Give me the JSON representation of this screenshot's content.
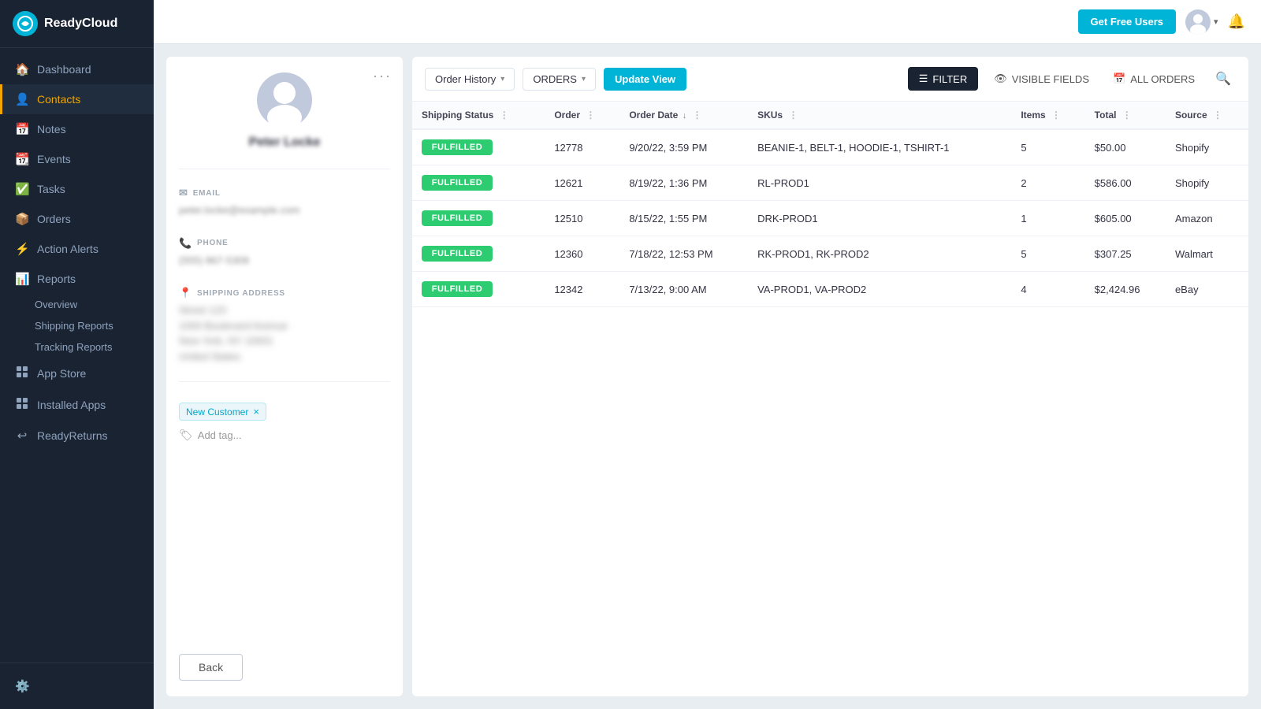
{
  "sidebar": {
    "logo": "ReadyCloud",
    "items": [
      {
        "id": "dashboard",
        "label": "Dashboard",
        "icon": "🏠",
        "active": false
      },
      {
        "id": "contacts",
        "label": "Contacts",
        "icon": "👤",
        "active": true
      },
      {
        "id": "notes",
        "label": "Notes",
        "icon": "📅",
        "active": false
      },
      {
        "id": "events",
        "label": "Events",
        "icon": "📆",
        "active": false
      },
      {
        "id": "tasks",
        "label": "Tasks",
        "icon": "✓",
        "active": false
      },
      {
        "id": "orders",
        "label": "Orders",
        "icon": "📦",
        "active": false
      },
      {
        "id": "action-alerts",
        "label": "Action Alerts",
        "icon": "⚡",
        "active": false
      },
      {
        "id": "reports",
        "label": "Reports",
        "icon": "📊",
        "active": false
      },
      {
        "id": "app-store",
        "label": "App Store",
        "icon": "⊞",
        "active": false
      },
      {
        "id": "installed-apps",
        "label": "Installed Apps",
        "icon": "⊞",
        "active": false
      },
      {
        "id": "ready-returns",
        "label": "ReadyReturns",
        "icon": "↩",
        "active": false
      }
    ],
    "sub_items": {
      "reports": [
        "Overview",
        "Shipping Reports",
        "Tracking Reports"
      ]
    }
  },
  "topbar": {
    "get_free_users_label": "Get Free Users",
    "notification_icon": "🔔"
  },
  "contact": {
    "name": "Peter Locke",
    "email_label": "EMAIL",
    "email_value": "peter.locke@example.com",
    "phone_label": "PHONE",
    "phone_value": "(555) 867-5309",
    "address_label": "SHIPPING ADDRESS",
    "address_lines": [
      "Street 123",
      "1000 Boulevard Avenue",
      "New York, NY 10001",
      "United States"
    ],
    "tags": [
      "New Customer"
    ],
    "add_tag_label": "Add tag..."
  },
  "orders": {
    "view_label": "Order History",
    "filter_dropdown": "ORDERS",
    "update_view_label": "Update View",
    "filter_label": "FILTER",
    "visible_fields_label": "VISIBLE FIELDS",
    "all_orders_label": "ALL ORDERS",
    "columns": [
      "Shipping Status",
      "Order",
      "Order Date",
      "SKUs",
      "Items",
      "Total",
      "Source"
    ],
    "rows": [
      {
        "status": "FULFILLED",
        "order": "12778",
        "date": "9/20/22, 3:59 PM",
        "skus": "BEANIE-1, BELT-1, HOODIE-1, TSHIRT-1",
        "items": "5",
        "total": "$50.00",
        "source": "Shopify"
      },
      {
        "status": "FULFILLED",
        "order": "12621",
        "date": "8/19/22, 1:36 PM",
        "skus": "RL-PROD1",
        "items": "2",
        "total": "$586.00",
        "source": "Shopify"
      },
      {
        "status": "FULFILLED",
        "order": "12510",
        "date": "8/15/22, 1:55 PM",
        "skus": "DRK-PROD1",
        "items": "1",
        "total": "$605.00",
        "source": "Amazon"
      },
      {
        "status": "FULFILLED",
        "order": "12360",
        "date": "7/18/22, 12:53 PM",
        "skus": "RK-PROD1, RK-PROD2",
        "items": "5",
        "total": "$307.25",
        "source": "Walmart"
      },
      {
        "status": "FULFILLED",
        "order": "12342",
        "date": "7/13/22, 9:00 AM",
        "skus": "VA-PROD1, VA-PROD2",
        "items": "4",
        "total": "$2,424.96",
        "source": "eBay"
      }
    ]
  },
  "buttons": {
    "back_label": "Back"
  }
}
